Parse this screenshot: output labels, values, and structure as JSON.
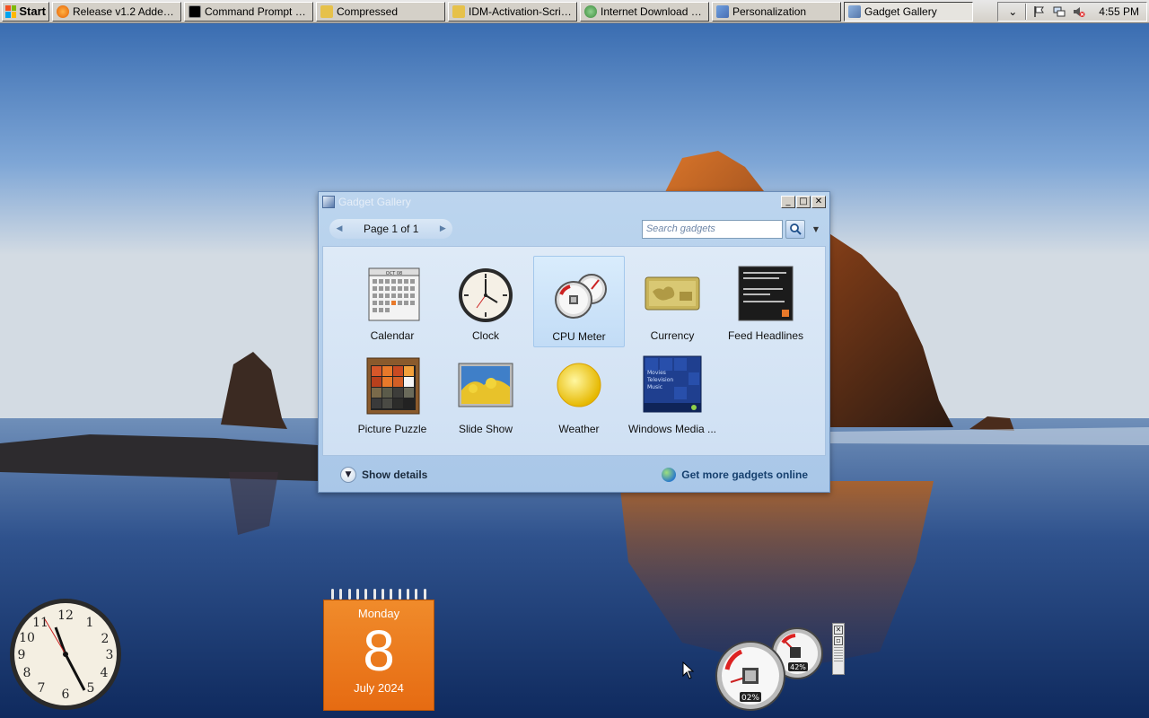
{
  "taskbar": {
    "start_label": "Start",
    "tasks": [
      {
        "label": "Release v1.2 Added b...",
        "icon": "firefox-icon",
        "color": "#e66000"
      },
      {
        "label": "Command Prompt - po...",
        "icon": "cmd-icon",
        "color": "#000000"
      },
      {
        "label": "Compressed",
        "icon": "folder-icon",
        "color": "#e6c14a"
      },
      {
        "label": "IDM-Activation-Script-...",
        "icon": "folder-icon",
        "color": "#e6c14a"
      },
      {
        "label": "Internet Download Ma...",
        "icon": "idm-icon",
        "color": "#3b8a3b"
      },
      {
        "label": "Personalization",
        "icon": "personalization-icon",
        "color": "#4a6fb3"
      },
      {
        "label": "Gadget Gallery",
        "icon": "gadget-icon",
        "color": "#5577aa"
      }
    ],
    "clock": "4:55 PM"
  },
  "gallery": {
    "title": "Gadget Gallery",
    "pager": "Page 1 of 1",
    "search_placeholder": "Search gadgets",
    "gadgets": [
      {
        "name": "Calendar",
        "icon": "calendar-gadget-icon"
      },
      {
        "name": "Clock",
        "icon": "clock-gadget-icon"
      },
      {
        "name": "CPU Meter",
        "icon": "cpu-meter-gadget-icon",
        "selected": true
      },
      {
        "name": "Currency",
        "icon": "currency-gadget-icon"
      },
      {
        "name": "Feed Headlines",
        "icon": "feed-headlines-gadget-icon"
      },
      {
        "name": "Picture Puzzle",
        "icon": "picture-puzzle-gadget-icon"
      },
      {
        "name": "Slide Show",
        "icon": "slide-show-gadget-icon"
      },
      {
        "name": "Weather",
        "icon": "weather-gadget-icon"
      },
      {
        "name": "Windows Media ...",
        "icon": "windows-media-gadget-icon"
      }
    ],
    "show_details": "Show details",
    "get_more": "Get more gadgets online",
    "cal_icon_month": "OCT 08"
  },
  "media_tile": {
    "lines": [
      "Movies",
      "Television",
      "Music"
    ]
  },
  "desktop_calendar": {
    "day_name": "Monday",
    "day_number": "8",
    "month_year": "July 2024"
  },
  "cpu_gadget": {
    "cpu_percent": "02%",
    "memory_percent": "42%"
  }
}
